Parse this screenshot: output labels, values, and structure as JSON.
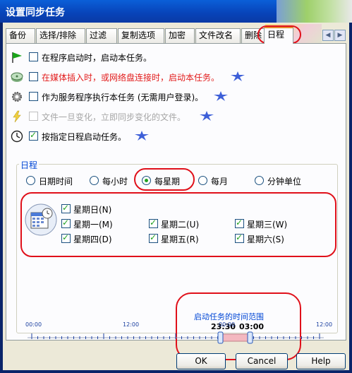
{
  "window": {
    "title": "设置同步任务"
  },
  "tabs": [
    {
      "label": "备份"
    },
    {
      "label": "选择/排除"
    },
    {
      "label": "过滤"
    },
    {
      "label": "复制选项"
    },
    {
      "label": "加密"
    },
    {
      "label": "文件改名"
    },
    {
      "label": "删除"
    },
    {
      "label": "日程"
    }
  ],
  "triggers": [
    {
      "label": "在程序启动时，启动本任务。",
      "checked": false,
      "icon": "flag-icon"
    },
    {
      "label": "在媒体插入时，或网络盘连接时，启动本任务。",
      "checked": false,
      "icon": "drive-icon",
      "color": "#e21c1c"
    },
    {
      "label": "作为服务程序执行本任务 (无需用户登录)。",
      "checked": false,
      "icon": "gear-icon"
    },
    {
      "label": "文件一旦变化，立即同步变化的文件。",
      "checked": false,
      "icon": "lightning-icon",
      "disabled": true
    },
    {
      "label": "按指定日程启动任务。",
      "checked": true,
      "icon": "clock-icon"
    }
  ],
  "schedule": {
    "group_title": "日程",
    "radios": [
      {
        "label": "日期时间",
        "selected": false
      },
      {
        "label": "每小时",
        "selected": false
      },
      {
        "label": "每星期",
        "selected": true
      },
      {
        "label": "每月",
        "selected": false
      },
      {
        "label": "分钟单位",
        "selected": false
      }
    ],
    "days": [
      {
        "label": "星期日(N)",
        "checked": true
      },
      {
        "label": "星期一(M)",
        "checked": true
      },
      {
        "label": "星期二(U)",
        "checked": true
      },
      {
        "label": "星期三(W)",
        "checked": true
      },
      {
        "label": "星期四(D)",
        "checked": true
      },
      {
        "label": "星期五(R)",
        "checked": true
      },
      {
        "label": "星期六(S)",
        "checked": true
      }
    ],
    "time_range_title": "启动任务的时间范围",
    "time_range_start": "23:30",
    "time_range_end": "03:00",
    "ticks": [
      "00:00",
      "12:00",
      "00:00",
      "12:00"
    ]
  },
  "buttons": {
    "ok": "OK",
    "cancel": "Cancel",
    "help": "Help"
  },
  "colors": {
    "accent": "#0046d5",
    "highlight": "#e0101a",
    "check": "#21a121"
  }
}
